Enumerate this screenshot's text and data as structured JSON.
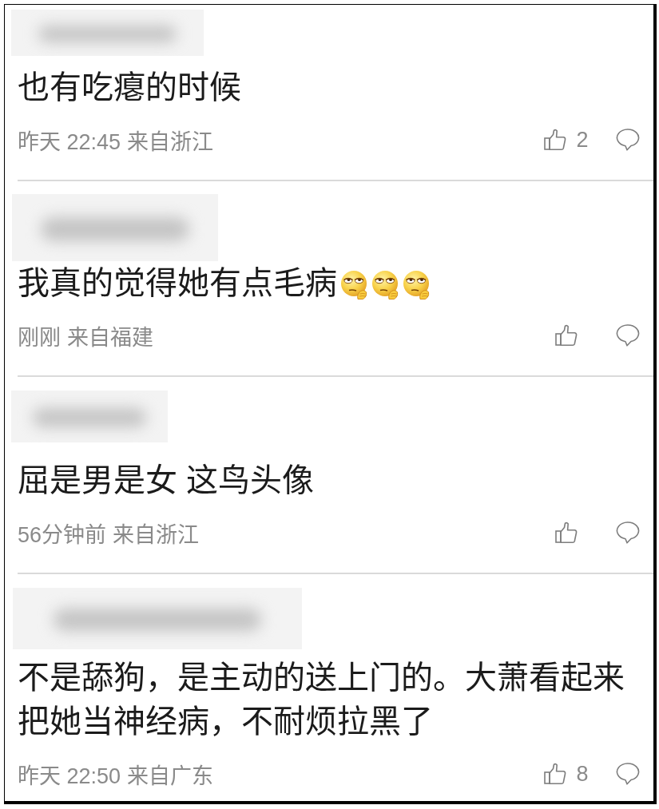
{
  "comments": [
    {
      "name_blurred": true,
      "body": [
        {
          "kind": "text",
          "text": "也有吃瘪的时候"
        }
      ],
      "time": "昨天 22:45",
      "location": "来自浙江",
      "likes": "2"
    },
    {
      "name_blurred": true,
      "body": [
        {
          "kind": "text",
          "text": "我真的觉得她有点毛病"
        },
        {
          "kind": "emoji"
        },
        {
          "kind": "emoji"
        },
        {
          "kind": "emoji"
        }
      ],
      "time": "刚刚",
      "location": "来自福建"
    },
    {
      "name_blurred": true,
      "body": [
        {
          "kind": "text",
          "text": "屈是男是女 这鸟头像"
        }
      ],
      "time": "56分钟前",
      "location": "来自浙江"
    },
    {
      "name_blurred": true,
      "body": [
        {
          "kind": "text",
          "text": "不是舔狗，是主动的送上门的。大萧看起来把她当神经病，不耐烦拉黑了"
        }
      ],
      "time": "昨天 22:50",
      "location": "来自广东",
      "likes": "8"
    }
  ]
}
